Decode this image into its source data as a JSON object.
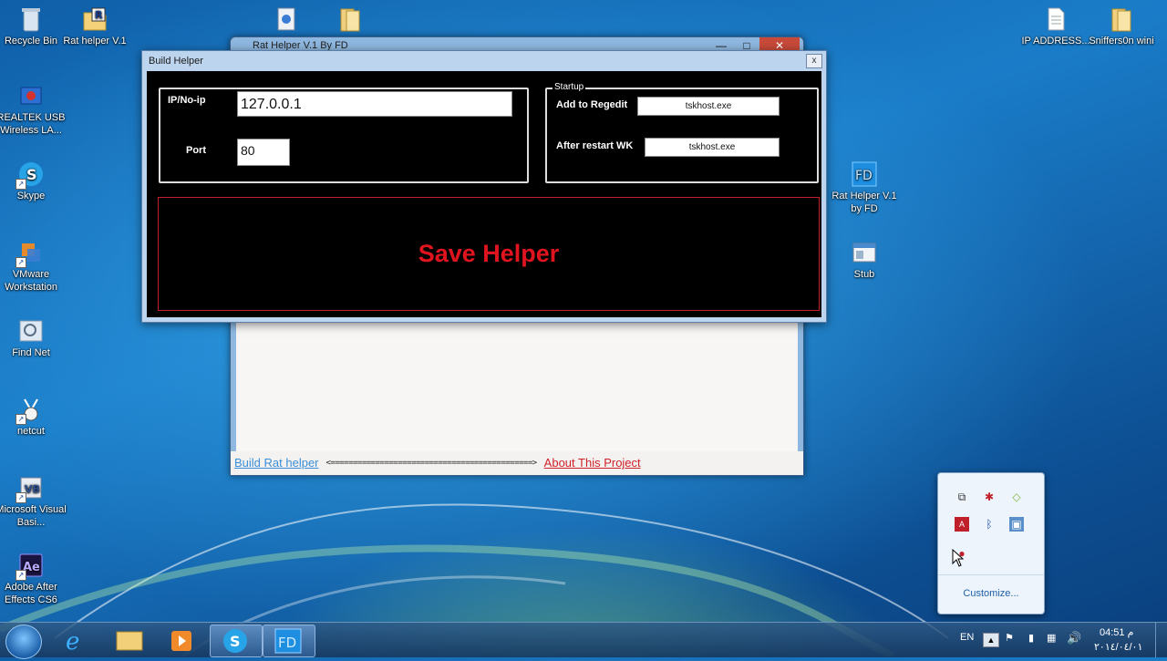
{
  "desktop_icons": [
    {
      "label": "Recycle Bin",
      "icon": "recycle-bin-icon"
    },
    {
      "label": "Rat helper V.1",
      "icon": "folder-icon"
    },
    {
      "label": "REALTEK USB Wireless LA...",
      "icon": "network-icon"
    },
    {
      "label": "Skype",
      "icon": "skype-icon"
    },
    {
      "label": "VMware Workstation",
      "icon": "vmware-icon"
    },
    {
      "label": "Find Net",
      "icon": "find-net-icon"
    },
    {
      "label": "netcut",
      "icon": "netcut-icon"
    },
    {
      "label": "Microsoft Visual Basi...",
      "icon": "visual-basic-icon"
    },
    {
      "label": "Adobe After Effects CS6",
      "icon": "after-effects-icon"
    },
    {
      "label": "IP ADDRESS...",
      "icon": "text-file-icon"
    },
    {
      "label": "Sniffers0n wini",
      "icon": "folder-icon"
    },
    {
      "label": "Rat Helper V.1 by FD",
      "icon": "fd-app-icon"
    },
    {
      "label": "Stub",
      "icon": "stub-window-icon"
    }
  ],
  "background_window": {
    "title": "Rat Helper V.1 By FD",
    "build_link": "Build Rat helper",
    "arrows": "<=============================================>",
    "about_link": "About This Project"
  },
  "dialog": {
    "title": "Build Helper",
    "close": "x",
    "ip_label": "IP/No-ip",
    "ip_value": "127.0.0.1",
    "port_label": "Port",
    "port_value": "80",
    "startup_group": "Startup",
    "regedit_label": "Add to Regedit",
    "regedit_value": "tskhost.exe",
    "restart_label": "After restart WK",
    "restart_value": "tskhost.exe",
    "save_button": "Save Helper"
  },
  "taskbar": {
    "language": "EN",
    "time": "04:51 م",
    "date": "٢٠١٤/٠٤/٠١",
    "items": [
      "ie-icon",
      "explorer-icon",
      "media-player-icon",
      "skype-icon",
      "fd-app-icon"
    ]
  },
  "tray_popup": {
    "customize": "Customize..."
  }
}
